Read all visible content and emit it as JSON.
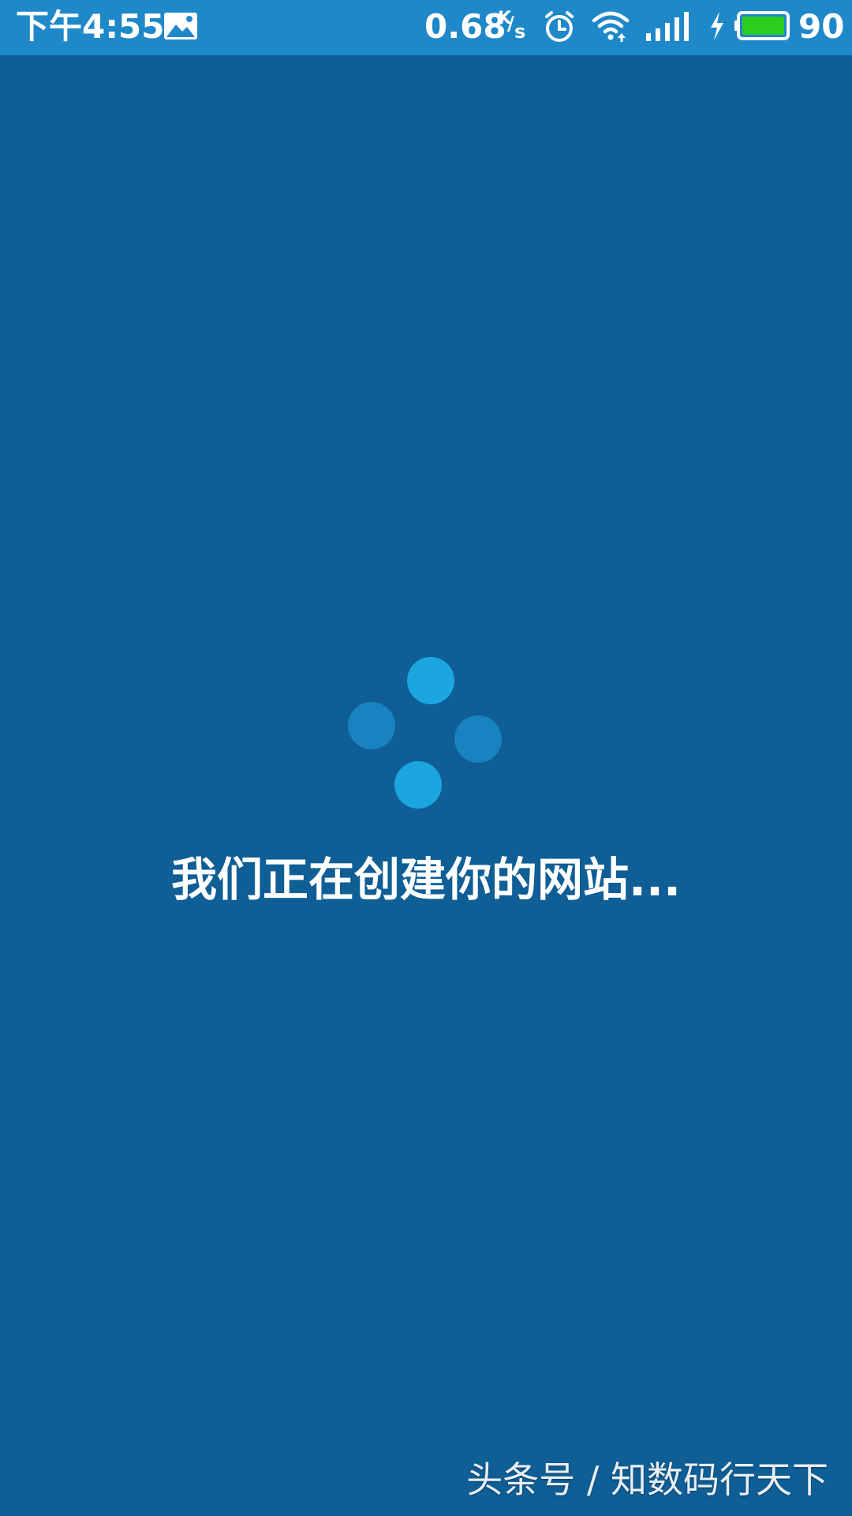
{
  "status_bar": {
    "time": "下午4:55",
    "speed_value": "0.68",
    "speed_unit_k": "K",
    "speed_unit_slash": "/",
    "speed_unit_s": "s",
    "battery_percent": "90",
    "icons": [
      "gallery-icon",
      "alarm-icon",
      "wifi-icon",
      "signal-icon",
      "charging-icon",
      "battery-icon"
    ],
    "colors": {
      "background": "#1f88c9",
      "battery_fill": "#2ecc1f"
    }
  },
  "loader": {
    "colors": {
      "bright": "#1ba6e0",
      "dim": "#1883c0"
    }
  },
  "main": {
    "message": "我们正在创建你的网站...",
    "background": "#0f5e96"
  },
  "watermark": {
    "text": "头条号 / 知数码行天下"
  }
}
